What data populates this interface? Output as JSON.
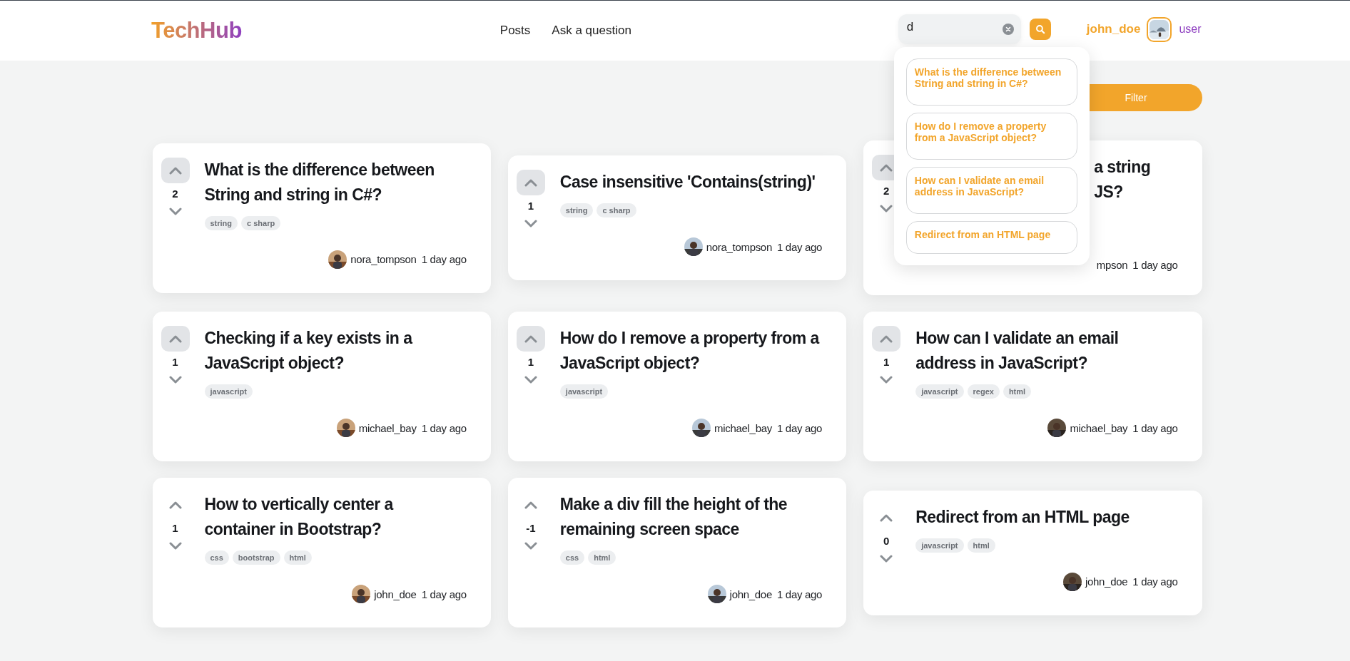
{
  "header": {
    "logo": "TechHub",
    "nav": [
      "Posts",
      "Ask a question"
    ],
    "search": {
      "value": "d"
    },
    "user": {
      "name": "john_doe",
      "role": "user"
    }
  },
  "search_suggestions": [
    {
      "title": "What is the difference between String and string in C#?"
    },
    {
      "title": "How do I remove a property from a JavaScript object?"
    },
    {
      "title": "How can I validate an email address in JavaScript?"
    },
    {
      "title": "Redirect from an HTML page"
    }
  ],
  "filter_button": "Filter",
  "posts": [
    {
      "kind": "full",
      "votes": "2",
      "upvoted": true,
      "title": "What is the difference between String and string in C#?",
      "tags": [
        "string",
        "c sharp"
      ],
      "author": "nora_tompson",
      "time": "1 day ago"
    },
    {
      "kind": "full",
      "votes": "1",
      "upvoted": true,
      "title": "Case insensitive 'Contains(string)'",
      "tags": [
        "string",
        "c sharp"
      ],
      "author": "nora_tompson",
      "time": "1 day ago"
    },
    {
      "kind": "covered",
      "votes": "2",
      "upvoted": true,
      "title_fragments": [
        "a string",
        "JS?"
      ],
      "author": "mpson",
      "time": "1 day ago"
    },
    {
      "kind": "full",
      "votes": "1",
      "upvoted": true,
      "title": "Checking if a key exists in a JavaScript object?",
      "tags": [
        "javascript"
      ],
      "author": "michael_bay",
      "time": "1 day ago"
    },
    {
      "kind": "full",
      "votes": "1",
      "upvoted": true,
      "title": "How do I remove a property from a JavaScript object?",
      "tags": [
        "javascript"
      ],
      "author": "michael_bay",
      "time": "1 day ago"
    },
    {
      "kind": "full",
      "votes": "1",
      "upvoted": true,
      "title": "How can I validate an email address in JavaScript?",
      "tags": [
        "javascript",
        "regex",
        "html"
      ],
      "author": "michael_bay",
      "time": "1 day ago"
    },
    {
      "kind": "full",
      "votes": "1",
      "upvoted": false,
      "title": "How to vertically center a container in Bootstrap?",
      "tags": [
        "css",
        "bootstrap",
        "html"
      ],
      "author": "john_doe",
      "time": "1 day ago"
    },
    {
      "kind": "full",
      "votes": "-1",
      "upvoted": false,
      "title": "Make a div fill the height of the remaining screen space",
      "tags": [
        "css",
        "html"
      ],
      "author": "john_doe",
      "time": "1 day ago"
    },
    {
      "kind": "full",
      "votes": "0",
      "upvoted": false,
      "title": "Redirect from an HTML page",
      "tags": [
        "javascript",
        "html"
      ],
      "author": "john_doe",
      "time": "1 day ago"
    }
  ]
}
